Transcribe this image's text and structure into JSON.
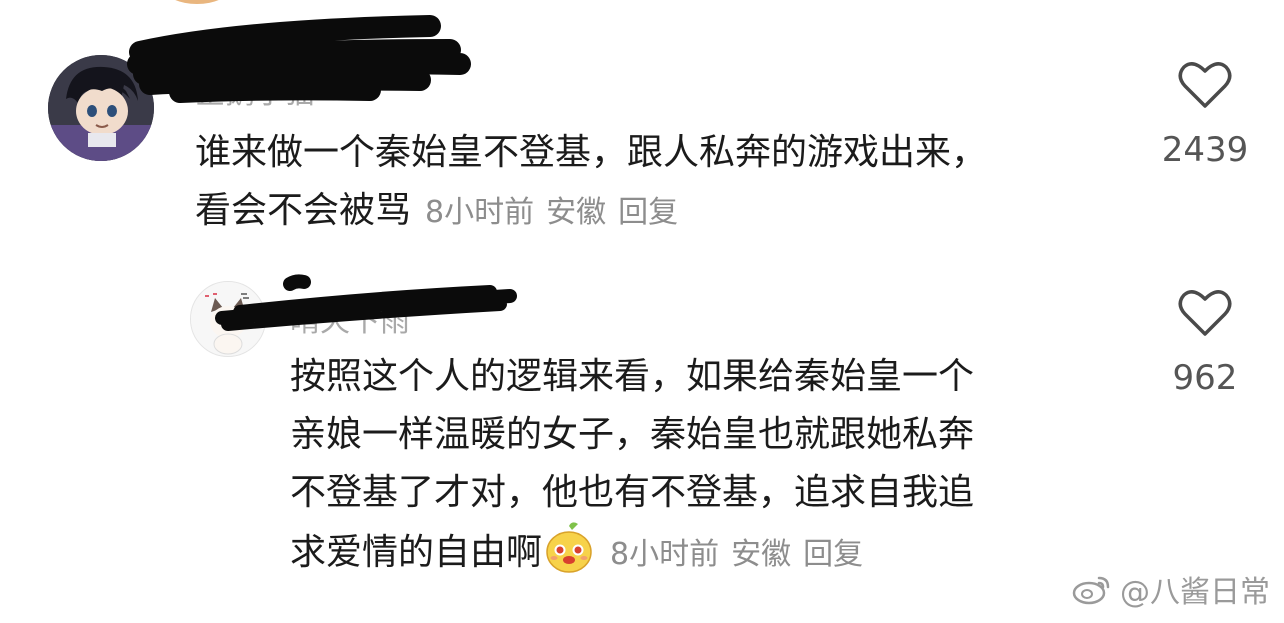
{
  "comments": [
    {
      "username": "企鹅小猫",
      "text_line1": "谁来做一个秦始皇不登基，跟人私奔的游戏出来，",
      "text_line2": "看会不会被骂",
      "time": "8小时前",
      "location": "安徽",
      "reply_label": "回复",
      "likes": "2439"
    },
    {
      "username": "晴天下雨",
      "text_line1": "按照这个人的逻辑来看，如果给秦始皇一个",
      "text_line2": "亲娘一样温暖的女子，秦始皇也就跟她私奔",
      "text_line3": "不登基了才对，他也有不登基，追求自我追",
      "text_line4": "求爱情的自由啊",
      "time": "8小时前",
      "location": "安徽",
      "reply_label": "回复",
      "likes": "962"
    }
  ],
  "watermark": {
    "text": "@八酱日常"
  }
}
